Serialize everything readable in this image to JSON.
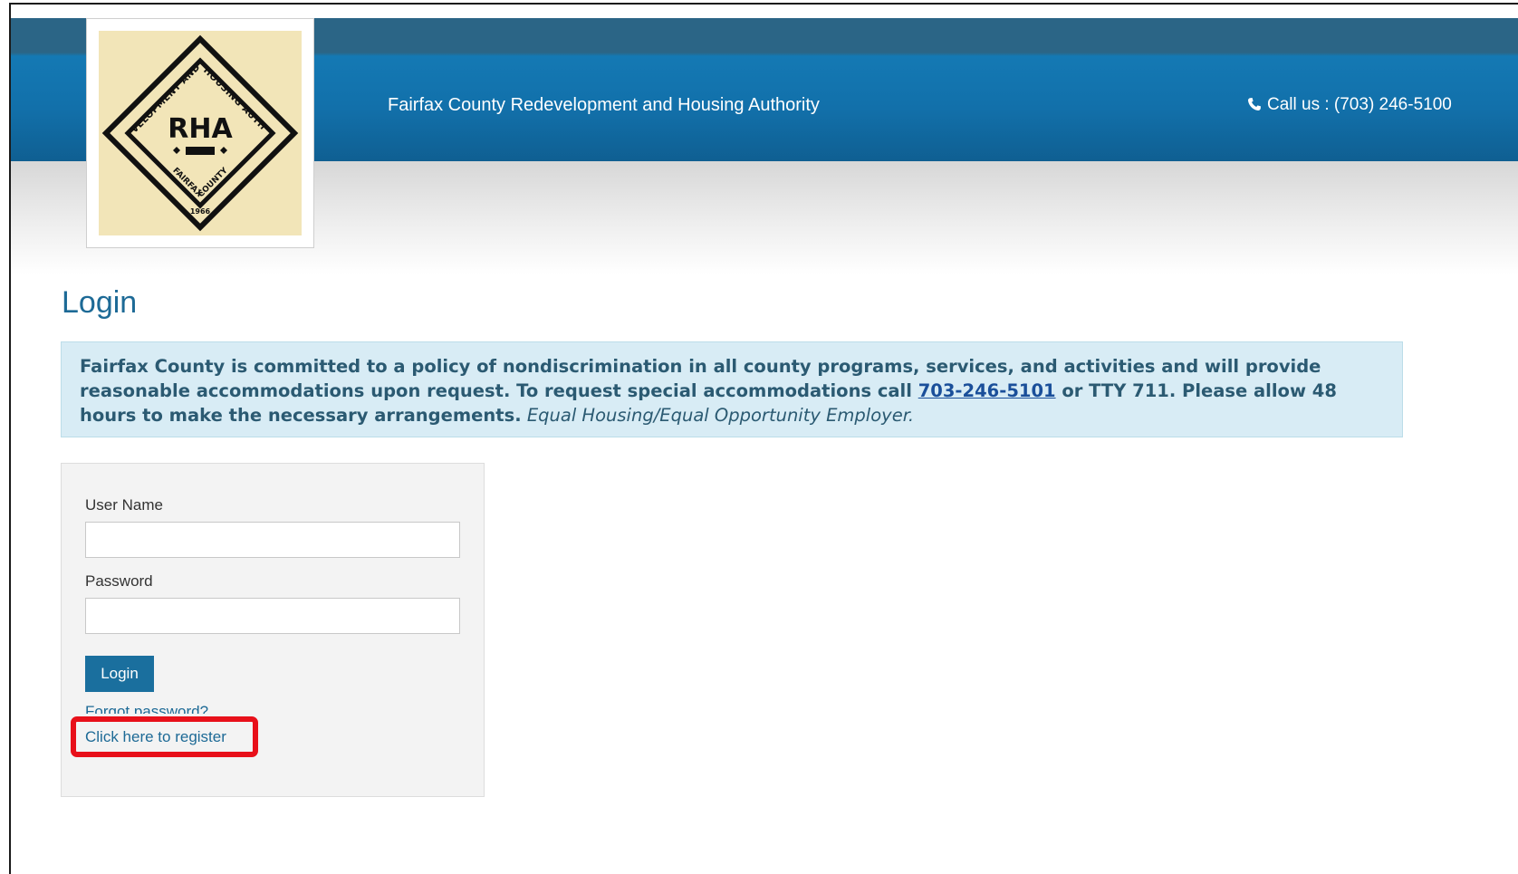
{
  "header": {
    "site_title": "Fairfax County Redevelopment and Housing Authority",
    "call_us": "Call us : (703) 246-5100",
    "logo": {
      "text": "RHA",
      "ring_top": "REDEVELOPMENT AND HOUSING AUTHORITY",
      "ring_bottom": "FAIRFAX COUNTY",
      "year": "1966"
    }
  },
  "page": {
    "title": "Login"
  },
  "notice": {
    "text_before": "Fairfax County is committed to a policy of nondiscrimination in all county programs, services, and activities and will provide reasonable accommodations upon request. To request special accommodations call ",
    "phone_link": "703-246-5101",
    "text_after": " or TTY 711. Please allow 48 hours to make the necessary arrangements.",
    "italic_text": "Equal Housing/Equal Opportunity Employer."
  },
  "login_form": {
    "username_label": "User Name",
    "username_value": "",
    "password_label": "Password",
    "password_value": "",
    "login_button": "Login",
    "forgot_password": "Forgot password?",
    "register_link": "Click here to register"
  },
  "colors": {
    "header_blue": "#1479b4",
    "header_top": "#2b6586",
    "title_blue": "#1d6a96",
    "notice_bg": "#d8ecf5",
    "button_blue": "#1a6f9e",
    "highlight_red": "#e8101a",
    "logo_bg": "#f2e5b8"
  }
}
